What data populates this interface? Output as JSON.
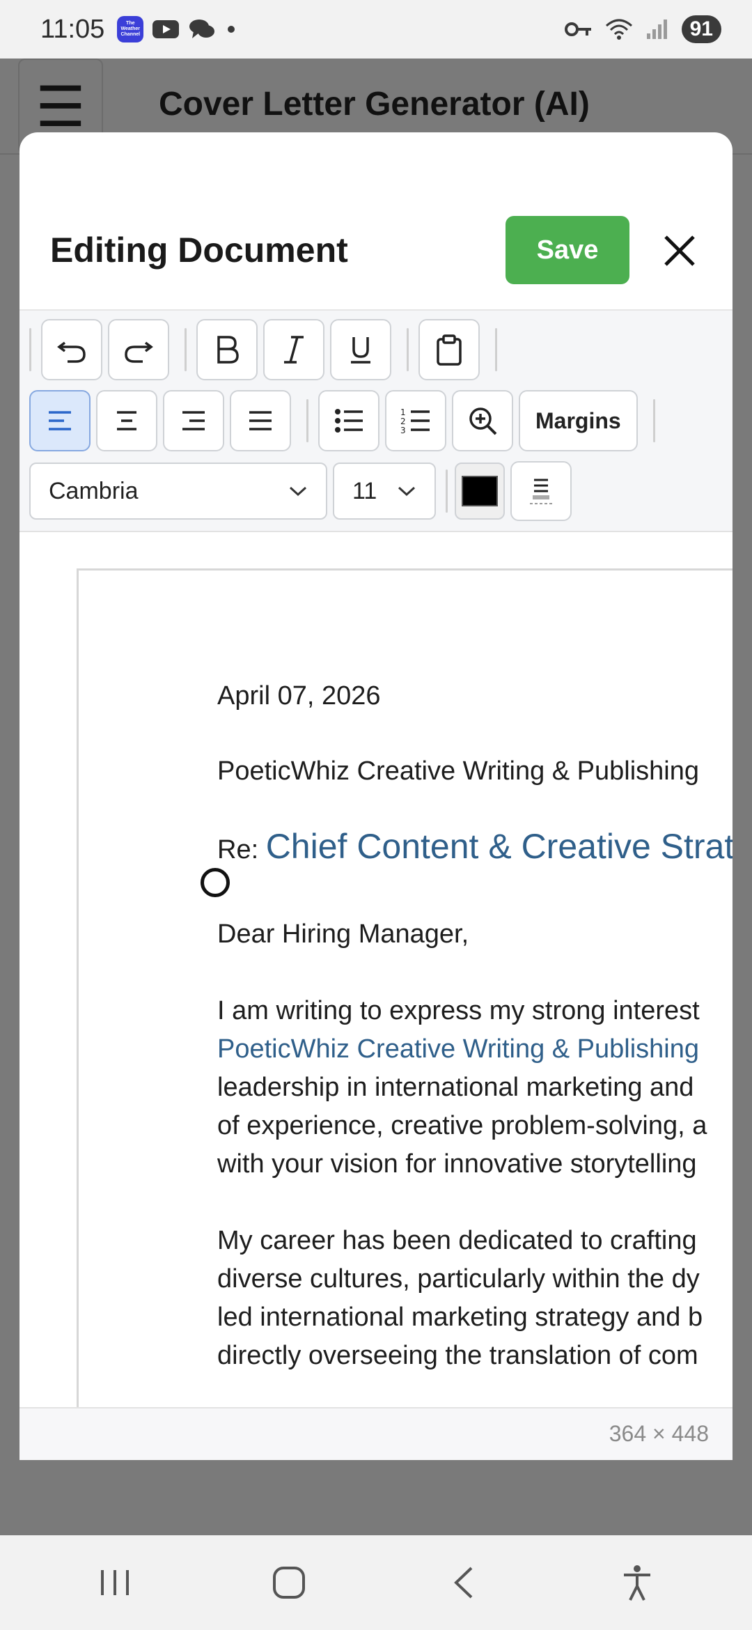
{
  "status_bar": {
    "time": "11:05",
    "weather_app": "The Weather Channel",
    "battery": "91"
  },
  "app": {
    "title": "Cover Letter Generator (AI)"
  },
  "modal": {
    "title": "Editing Document",
    "save_label": "Save"
  },
  "toolbar": {
    "margins_label": "Margins",
    "font_family": "Cambria",
    "font_size": "11",
    "text_color": "#000000"
  },
  "document": {
    "date": "April 07, 2026",
    "company": "PoeticWhiz Creative Writing & Publishing",
    "re_prefix": "Re:",
    "re_title": "Chief Content & Creative Strat",
    "salutation": "Dear Hiring Manager,",
    "p1_l1": "I am writing to express my strong interest",
    "p1_l2": "PoeticWhiz Creative Writing & Publishing",
    "p1_l3": "leadership in international marketing and",
    "p1_l4": "of experience, creative problem-solving, a",
    "p1_l5": "with your vision for innovative storytelling",
    "p2_l1": "My career has been dedicated to crafting",
    "p2_l2": "diverse cultures, particularly within the dy",
    "p2_l3": "led international marketing strategy and b",
    "p2_l4": "directly overseeing the translation of com"
  },
  "footer": {
    "dimensions": "364 × 448"
  },
  "colors": {
    "save": "#4caf50",
    "link": "#2f5f8a",
    "active_align": "#dbe8fb"
  }
}
